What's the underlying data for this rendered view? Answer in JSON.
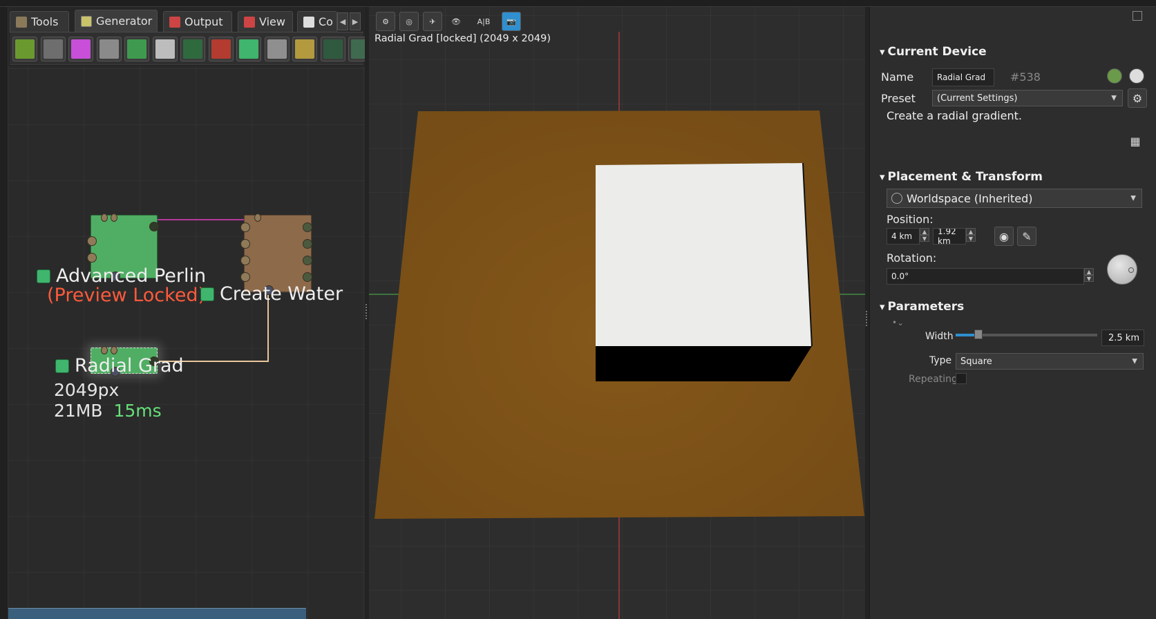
{
  "tabs": [
    {
      "label": "Tools",
      "icon": "wrench-icon"
    },
    {
      "label": "Generator",
      "icon": "generator-icon"
    },
    {
      "label": "Output",
      "icon": "output-icon"
    },
    {
      "label": "View",
      "icon": "view-icon"
    },
    {
      "label": "Co",
      "icon": "code-icon"
    }
  ],
  "toolbar_devices": [
    {
      "name": "terrain-device",
      "color": "#6a9a2f"
    },
    {
      "name": "noise-device",
      "color": "#6e6e6e"
    },
    {
      "name": "colorize-device",
      "color": "#c84fd8"
    },
    {
      "name": "constant-device",
      "color": "#8a8a8a"
    },
    {
      "name": "file-input-device",
      "color": "#3f9a4f"
    },
    {
      "name": "gradient-device",
      "color": "#bdbdbd"
    },
    {
      "name": "pattern-device",
      "color": "#2f6a3f"
    },
    {
      "name": "red-device",
      "color": "#b33b2f"
    },
    {
      "name": "green-device",
      "color": "#3fb56d"
    },
    {
      "name": "mound-device",
      "color": "#8f8f8f"
    },
    {
      "name": "map-device",
      "color": "#b39a3f"
    },
    {
      "name": "tiles-device",
      "color": "#2f5a3f"
    },
    {
      "name": "voronoi-device",
      "color": "#3f6a4f"
    }
  ],
  "graph": {
    "nodes": {
      "advanced_perlin": {
        "label": "Advanced Perlin",
        "status": "(Preview Locked)"
      },
      "create_water": {
        "label": "Create Water"
      },
      "radial_grad": {
        "label": "Radial Grad",
        "resolution": "2049px",
        "memory": "21MB",
        "time": "15ms"
      }
    }
  },
  "viewport": {
    "title": "Radial Grad [locked] (2049 x 2049)",
    "buttons": [
      "settings-icon",
      "orbit-icon",
      "free-icon",
      "eye-icon",
      "A|B",
      "camera-icon"
    ]
  },
  "inspector": {
    "current_device": {
      "section": "Current Device",
      "name_label": "Name",
      "name_value": "Radial Grad",
      "id": "#538",
      "preset_label": "Preset",
      "preset_value": "(Current Settings)",
      "description": "Create a radial gradient."
    },
    "placement": {
      "section": "Placement & Transform",
      "space": "Worldspace (Inherited)",
      "position_label": "Position:",
      "pos_x": "4 km",
      "pos_y": "1.92 km",
      "rotation_label": "Rotation:",
      "rotation": "0.0°"
    },
    "parameters": {
      "section": "Parameters",
      "width_label": "Width",
      "width_value": "2.5 km",
      "width_fraction": 0.16,
      "type_label": "Type",
      "type_value": "Square",
      "repeating_label": "Repeating",
      "repeating": false
    }
  },
  "colors": {
    "node_green": "#4fae63",
    "node_brown": "#8d6a4a",
    "terrain": "#7c5218",
    "wire_pink": "#b53a9a",
    "wire_tan": "#e9c79c",
    "accent_blue": "#2f8fcf"
  }
}
